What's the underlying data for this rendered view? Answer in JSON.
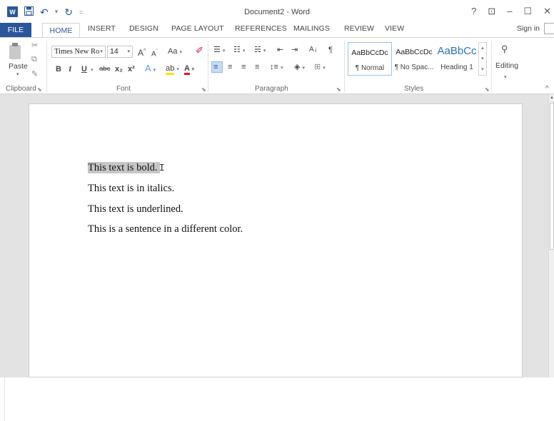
{
  "app": {
    "title": "Document2 - Word",
    "logo_letter": "W"
  },
  "window_controls": {
    "help": "?",
    "ribbon_display": "⊡",
    "minimize": "–",
    "maximize": "☐",
    "close": "✕"
  },
  "quick_access": {
    "save_icon": "save-icon",
    "undo_icon": "undo-icon",
    "redo_icon": "redo-icon",
    "customize": "="
  },
  "tabs": [
    {
      "label": "FILE"
    },
    {
      "label": "HOME"
    },
    {
      "label": "INSERT"
    },
    {
      "label": "DESIGN"
    },
    {
      "label": "PAGE LAYOUT"
    },
    {
      "label": "REFERENCES"
    },
    {
      "label": "MAILINGS"
    },
    {
      "label": "REVIEW"
    },
    {
      "label": "VIEW"
    }
  ],
  "signin_label": "Sign in",
  "ribbon": {
    "clipboard": {
      "paste_label": "Paste",
      "group_label": "Clipboard"
    },
    "font": {
      "font_name": "Times New Ro",
      "font_size": "14",
      "grow": "A",
      "shrink": "A",
      "change_case": "Aa",
      "bold": "B",
      "italic": "I",
      "underline": "U",
      "strikethrough": "abc",
      "subscript": "x₂",
      "superscript": "x²",
      "text_effects": "A",
      "highlight": "ab",
      "font_color": "A",
      "group_label": "Font"
    },
    "paragraph": {
      "group_label": "Paragraph",
      "show_marks": "¶",
      "sort": "A↓"
    },
    "styles": {
      "group_label": "Styles",
      "items": [
        {
          "sample": "AaBbCcDc",
          "name": "¶ Normal"
        },
        {
          "sample": "AaBbCcDc",
          "name": "¶ No Spac..."
        },
        {
          "sample": "AaBbCc",
          "name": "Heading 1"
        }
      ]
    },
    "editing": {
      "label": "Editing"
    }
  },
  "document": {
    "lines": [
      {
        "text": "This text is bold."
      },
      {
        "text": "This text is in italics."
      },
      {
        "text": "This text is underlined."
      },
      {
        "text": "This is a sentence in a different color."
      }
    ]
  },
  "colors": {
    "accent": "#2b579a",
    "heading_style": "#2e74b5",
    "selection": "#c6c6c6",
    "highlight": "#ffe000",
    "font_color": "#e81123"
  }
}
